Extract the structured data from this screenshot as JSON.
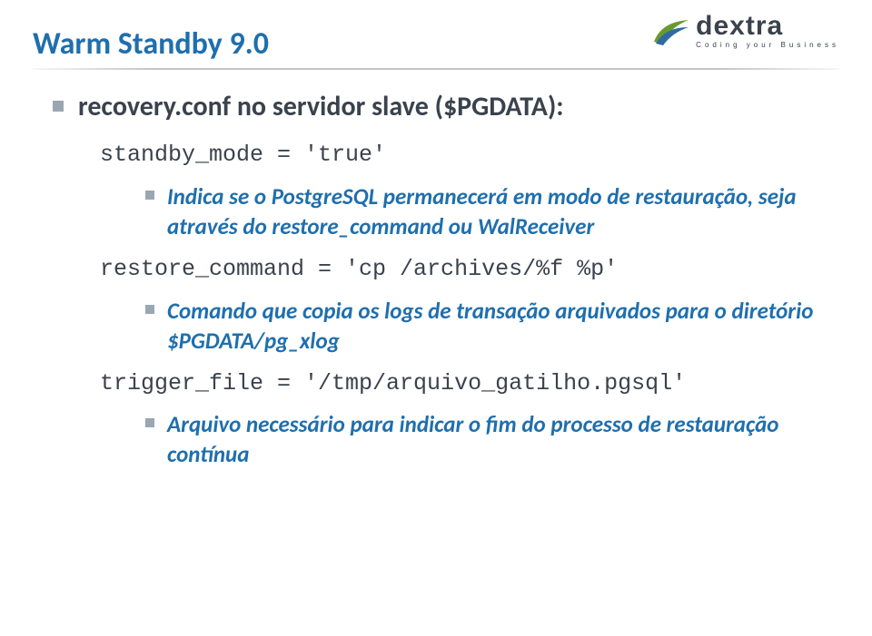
{
  "logo": {
    "name": "dextra",
    "tagline": "Coding your Business"
  },
  "title": "Warm Standby 9.0",
  "level1": "recovery.conf no servidor slave ($PGDATA):",
  "code1": "standby_mode = 'true'",
  "sub1": "Indica se o PostgreSQL permanecerá em modo de restauração, seja através do restore_command ou WalReceiver",
  "code2": "restore_command = 'cp /archives/%f %p'",
  "sub2": "Comando que copia os logs de transação arquivados para o diretório $PGDATA/pg_xlog",
  "code3": "trigger_file = '/tmp/arquivo_gatilho.pgsql'",
  "sub3": "Arquivo necessário para indicar o fim do processo de restauração contínua"
}
